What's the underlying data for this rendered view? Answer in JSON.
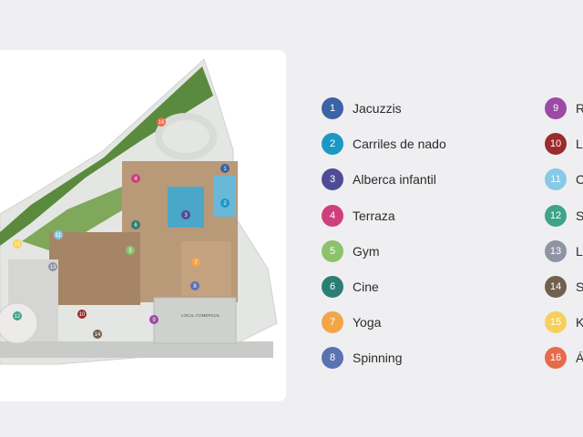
{
  "map": {
    "local_comercial_label": "LOCAL COMERCIAL",
    "markers": [
      "1",
      "2",
      "3",
      "4",
      "5",
      "6",
      "7",
      "8",
      "9",
      "10",
      "11",
      "12",
      "13",
      "14",
      "15",
      "16"
    ]
  },
  "legend": {
    "items": [
      {
        "num": "1",
        "label": "Jacuzzis",
        "color": "#3b63a6"
      },
      {
        "num": "2",
        "label": "Carriles de nado",
        "color": "#1b98c5"
      },
      {
        "num": "3",
        "label": "Alberca infantil",
        "color": "#4f4c96"
      },
      {
        "num": "4",
        "label": "Terraza",
        "color": "#cf3f7e"
      },
      {
        "num": "5",
        "label": "Gym",
        "color": "#8cc16d"
      },
      {
        "num": "6",
        "label": "Cine",
        "color": "#2c7e74"
      },
      {
        "num": "7",
        "label": "Yoga",
        "color": "#f2a648"
      },
      {
        "num": "8",
        "label": "Spinning",
        "color": "#5a72b2"
      },
      {
        "num": "9",
        "label": "R",
        "color": "#9c4aa6"
      },
      {
        "num": "10",
        "label": "L",
        "color": "#9c2b2d"
      },
      {
        "num": "11",
        "label": "C",
        "color": "#88c9e6"
      },
      {
        "num": "12",
        "label": "S",
        "color": "#3ea38a"
      },
      {
        "num": "13",
        "label": "L",
        "color": "#9093a3"
      },
      {
        "num": "14",
        "label": "S",
        "color": "#72604f"
      },
      {
        "num": "15",
        "label": "K",
        "color": "#f6d05a"
      },
      {
        "num": "16",
        "label": "Á",
        "color": "#e86a4b"
      }
    ]
  }
}
